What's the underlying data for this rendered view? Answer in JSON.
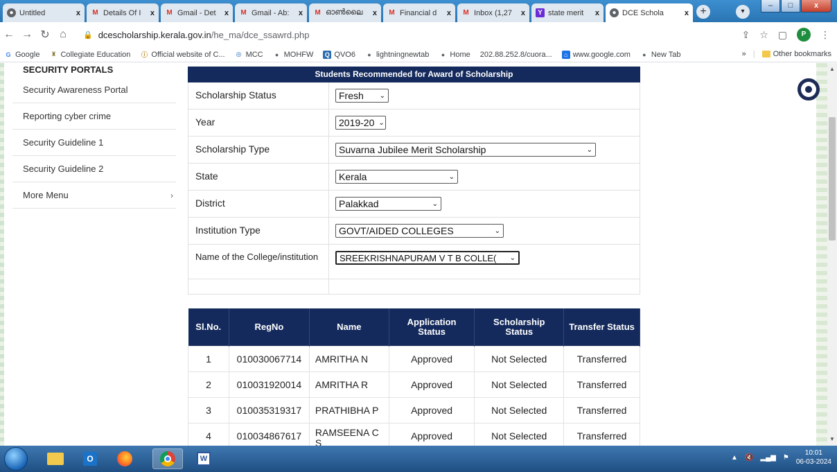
{
  "tabs": [
    {
      "label": "Untitled",
      "icon": "globe-icon"
    },
    {
      "label": "Details Of I",
      "icon": "gmail-icon"
    },
    {
      "label": "Gmail - Det",
      "icon": "gmail-icon"
    },
    {
      "label": "Gmail - Ab:",
      "icon": "gmail-icon"
    },
    {
      "label": "ഓൺലൈ",
      "icon": "gmail-icon"
    },
    {
      "label": "Financial d",
      "icon": "gmail-icon"
    },
    {
      "label": "Inbox (1,27",
      "icon": "gmail-icon"
    },
    {
      "label": "state merit",
      "icon": "yahoo-icon"
    },
    {
      "label": "DCE Schola",
      "icon": "globe-icon"
    }
  ],
  "close_glyph": "x",
  "url": {
    "host": "dcescholarship.kerala.gov.in",
    "path": "/he_ma/dce_ssawrd.php"
  },
  "profile_initial": "P",
  "bookmarks": [
    {
      "label": "Google",
      "icon": "google-icon"
    },
    {
      "label": "Collegiate Education",
      "icon": "emblem-icon"
    },
    {
      "label": "Official website of C...",
      "icon": "info-icon"
    },
    {
      "label": "MCC",
      "icon": "globe-icon"
    },
    {
      "label": "MOHFW",
      "icon": "globe-icon"
    },
    {
      "label": "QVO6",
      "icon": "q-icon"
    },
    {
      "label": "lightningnewtab",
      "icon": "globe-icon"
    },
    {
      "label": "Home",
      "icon": "globe-icon"
    },
    {
      "label": "202.88.252.8/cuora...",
      "icon": ""
    },
    {
      "label": "www.google.com",
      "icon": "home-icon"
    },
    {
      "label": "New Tab",
      "icon": "globe-icon"
    }
  ],
  "bookmarks_overflow": "»",
  "other_bookmarks": "Other bookmarks",
  "sidebar": {
    "title": "SECURITY PORTALS",
    "items": [
      {
        "label": "Security Awareness Portal"
      },
      {
        "label": "Reporting cyber crime"
      },
      {
        "label": "Security Guideline 1"
      },
      {
        "label": "Security Guideline 2"
      },
      {
        "label": "More Menu"
      }
    ]
  },
  "form": {
    "title": "Students Recommended for Award of Scholarship",
    "fields": [
      {
        "label": "Scholarship Status",
        "value": "Fresh"
      },
      {
        "label": "Year",
        "value": "2019-20"
      },
      {
        "label": "Scholarship Type",
        "value": "Suvarna Jubilee Merit Scholarship"
      },
      {
        "label": "State",
        "value": "Kerala"
      },
      {
        "label": "District",
        "value": "Palakkad"
      },
      {
        "label": "Institution Type",
        "value": "GOVT/AIDED COLLEGES"
      },
      {
        "label": "Name of the College/institution",
        "value": "SREEKRISHNAPURAM V T B COLLE("
      }
    ]
  },
  "results": {
    "headers": [
      "Sl.No.",
      "RegNo",
      "Name",
      "Application Status",
      "Scholarship Status",
      "Transfer Status"
    ],
    "rows": [
      [
        "1",
        "010030067714",
        "AMRITHA N",
        "Approved",
        "Not Selected",
        "Transferred"
      ],
      [
        "2",
        "010031920014",
        "AMRITHA R",
        "Approved",
        "Not Selected",
        "Transferred"
      ],
      [
        "3",
        "010035319317",
        "PRATHIBHA P",
        "Approved",
        "Not Selected",
        "Transferred"
      ],
      [
        "4",
        "010034867617",
        "RAMSEENA C S",
        "Approved",
        "Not Selected",
        "Transferred"
      ]
    ]
  },
  "clock": {
    "time": "10:01",
    "date": "06-03-2024"
  },
  "colors": {
    "header_navy": "#142a5c",
    "tab_strip": "#2a75b3"
  }
}
